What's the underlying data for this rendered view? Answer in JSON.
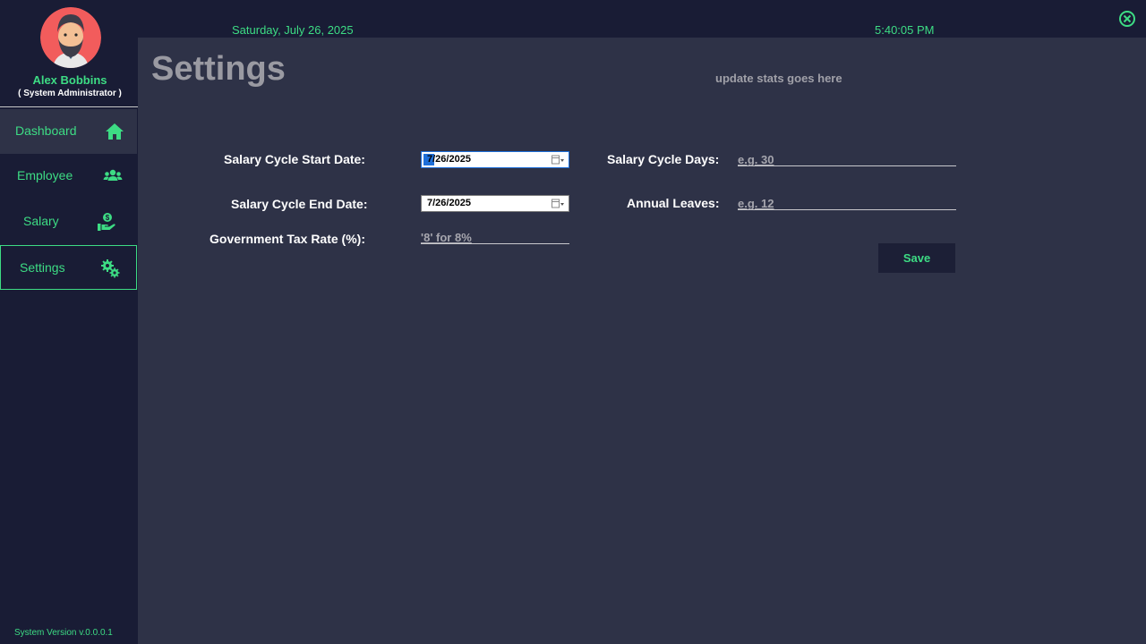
{
  "header": {
    "date": "Saturday, July 26, 2025",
    "time": "5:40:05 PM",
    "close_icon": "close-circle-icon"
  },
  "user": {
    "name": "Alex Bobbins",
    "role": "( System Administrator )",
    "avatar_icon": "bearded-man-avatar"
  },
  "sidebar": {
    "items": [
      {
        "label": "Dashboard",
        "icon": "home-icon",
        "state": "hover"
      },
      {
        "label": "Employee",
        "icon": "users-icon",
        "state": "normal"
      },
      {
        "label": "Salary",
        "icon": "salary-hand-icon",
        "state": "normal"
      },
      {
        "label": "Settings",
        "icon": "gears-icon",
        "state": "active"
      }
    ],
    "version": "System Version v.0.0.0.1"
  },
  "page": {
    "title": "Settings",
    "update_stats": "update stats goes here"
  },
  "form": {
    "start_date_label": "Salary Cycle Start Date:",
    "start_date_value": "7/26/2025",
    "end_date_label": "Salary Cycle End Date:",
    "end_date_value": "7/26/2025",
    "tax_label": "Government Tax Rate (%):",
    "tax_placeholder": "'8' for 8%",
    "cycle_days_label": "Salary Cycle Days:",
    "cycle_days_placeholder": "e.g. 30",
    "leaves_label": "Annual Leaves:",
    "leaves_placeholder": "e.g. 12",
    "save_label": "Save"
  },
  "colors": {
    "accent": "#3ddc84",
    "sidebar_bg": "#191c35",
    "main_bg": "#2e3247"
  }
}
